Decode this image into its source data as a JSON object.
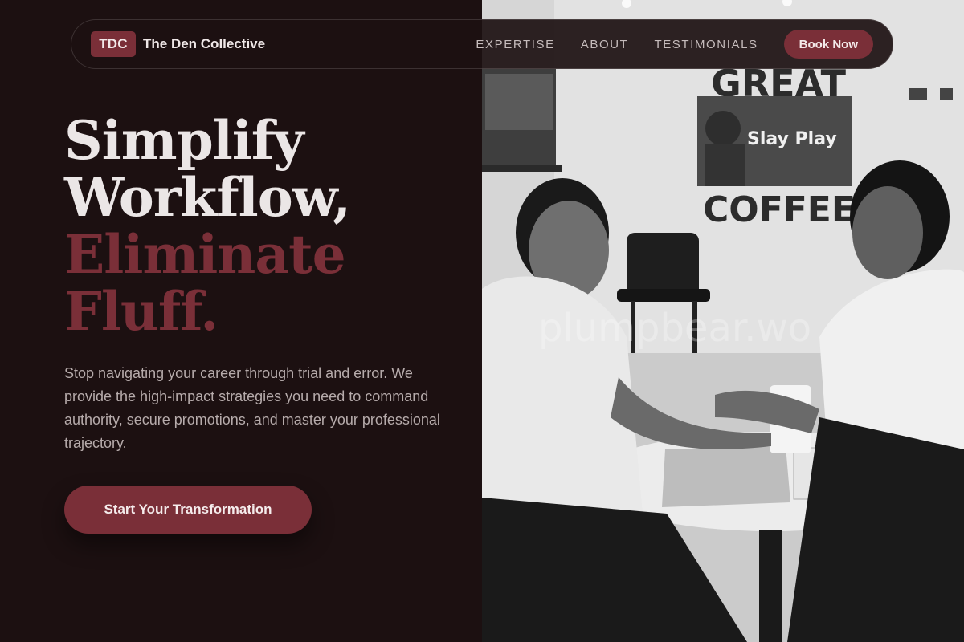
{
  "nav": {
    "logo_text": "TDC",
    "brand_name": "The Den Collective",
    "links": [
      "EXPERTISE",
      "ABOUT",
      "TESTIMONIALS"
    ],
    "cta_label": "Book Now"
  },
  "hero": {
    "headline_line1": "Simplify",
    "headline_line2": "Workflow,",
    "headline_line3": "Eliminate",
    "headline_line4": "Fluff.",
    "subtext": "Stop navigating your career through trial and error. We provide the high-impact strategies you need to command authority, secure promotions, and master your professional trajectory.",
    "cta_label": "Start Your Transformation"
  },
  "photo": {
    "description_icon": "photo-two-women-meeting-at-cafe",
    "wall_sign_top": "GREAT",
    "wall_sign_bottom": "COFFEE",
    "poster_text": "Slay Play",
    "watermark": "plumpbear.wo"
  },
  "colors": {
    "background": "#1c1011",
    "accent": "#7a2f38",
    "headline_light": "#ebe6e6",
    "body_text": "#b6abab"
  }
}
